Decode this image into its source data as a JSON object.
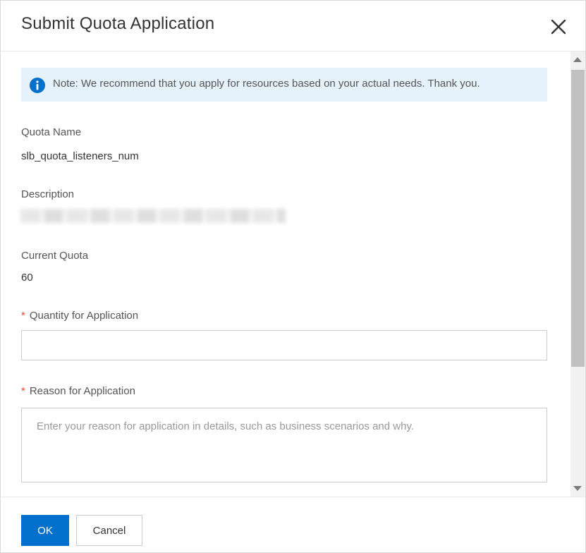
{
  "dialog": {
    "title": "Submit Quota Application"
  },
  "note": {
    "text": "Note: We recommend that you apply for resources based on your actual needs. Thank you."
  },
  "fields": {
    "quota_name": {
      "label": "Quota Name",
      "value": "slb_quota_listeners_num"
    },
    "description": {
      "label": "Description"
    },
    "current_quota": {
      "label": "Current Quota",
      "value": "60"
    },
    "quantity": {
      "required_mark": "*",
      "label": "Quantity for Application",
      "value": ""
    },
    "reason": {
      "required_mark": "*",
      "label": "Reason for Application",
      "placeholder": "Enter your reason for application in details, such as business scenarios and why."
    }
  },
  "footer": {
    "ok_label": "OK",
    "cancel_label": "Cancel"
  },
  "colors": {
    "primary": "#0070cc",
    "info_bg": "#e5f2fc",
    "required": "#e84738"
  },
  "icons": [
    "close-icon",
    "info-icon",
    "scroll-up-arrow-icon",
    "scroll-down-arrow-icon"
  ]
}
